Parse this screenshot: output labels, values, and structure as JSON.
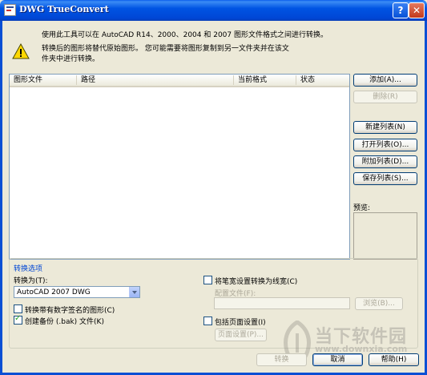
{
  "window": {
    "title": "DWG TrueConvert",
    "help_glyph": "?",
    "close_glyph": "✕"
  },
  "intro": {
    "line1": "使用此工具可以在 AutoCAD R14、2000、2004 和 2007 图形文件格式之间进行转换。",
    "warning_line1": "转换后的图形将替代原始图形。 您可能需要将图形复制到另一文件夹并在该文",
    "warning_line2": "件夹中进行转换。"
  },
  "file_list": {
    "columns": [
      "图形文件",
      "路径",
      "当前格式",
      "状态"
    ],
    "rows": []
  },
  "buttons": {
    "add": "添加(A)...",
    "remove": "删除(R)",
    "new_list": "新建列表(N)",
    "open_list": "打开列表(O)...",
    "append_list": "附加列表(D)...",
    "save_list": "保存列表(S)...",
    "browse": "浏览(B)...",
    "page_setup": "页面设置(P)...",
    "convert": "转换",
    "cancel": "取消",
    "help": "帮助(H)"
  },
  "preview": {
    "label": "预览:"
  },
  "options": {
    "group_title": "转换选项",
    "convert_to_label": "转换为(T):",
    "convert_to_value": "AutoCAD 2007 DWG",
    "convert_signed_label": "转换带有数字签名的图形(C)",
    "convert_signed_checked": false,
    "create_backup_label": "创建备份 (.bak) 文件(K)",
    "create_backup_checked": true,
    "lineweight_label": "将笔宽设置转换为线宽(C)",
    "lineweight_checked": false,
    "config_file_label": "配置文件(F):",
    "config_file_value": "",
    "page_setup_label": "包括页面设置(I)",
    "page_setup_checked": false
  },
  "watermark": {
    "name": "当下软件园",
    "url": "www.downxia.com"
  },
  "colors": {
    "titlebar": "#0054E3",
    "dialog_bg": "#ECE9D8",
    "group_title": "#0046D5"
  }
}
